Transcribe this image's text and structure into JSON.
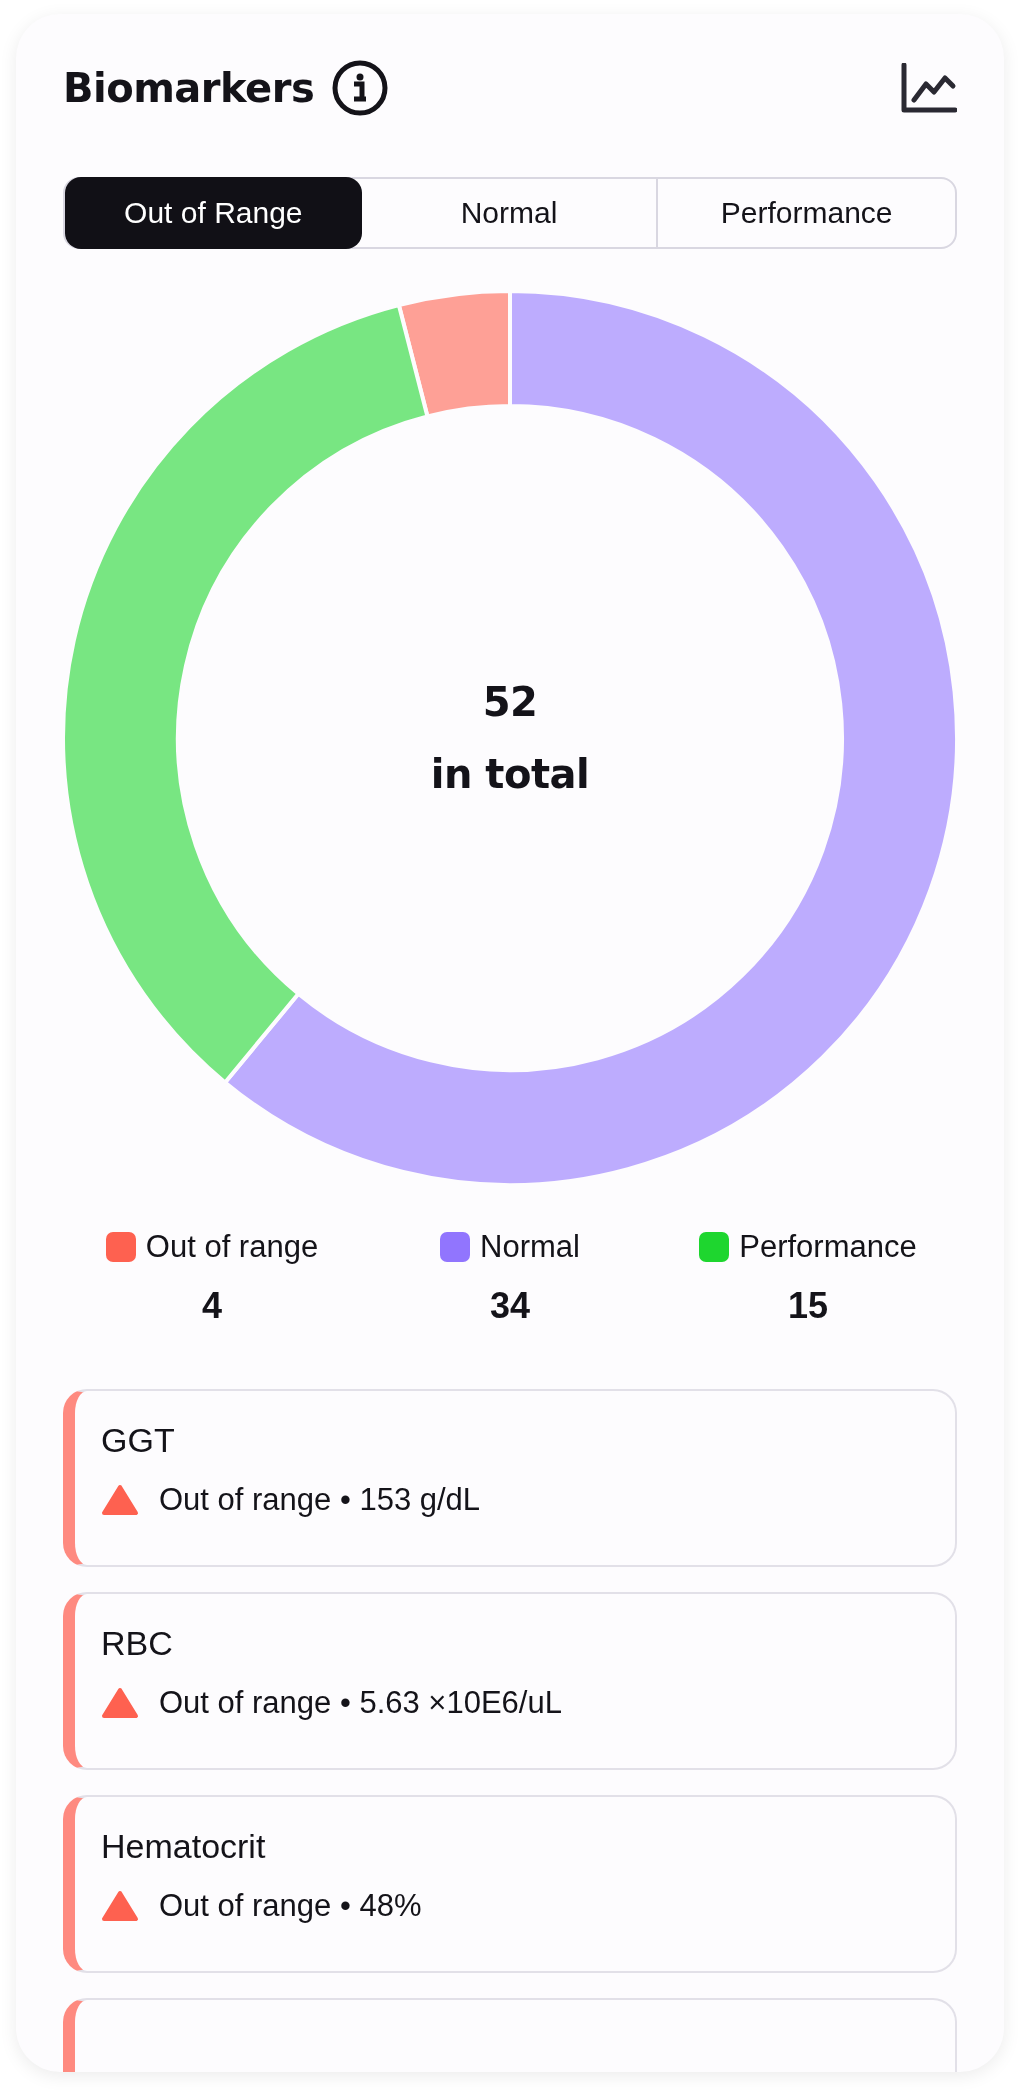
{
  "header": {
    "title": "Biomarkers"
  },
  "tabs": [
    {
      "label": "Out of Range",
      "selected": true
    },
    {
      "label": "Normal",
      "selected": false
    },
    {
      "label": "Performance",
      "selected": false
    }
  ],
  "summary": {
    "total": "52",
    "caption": "in total",
    "chart_data": {
      "type": "donut",
      "categories": [
        "Out of range",
        "Normal",
        "Performance"
      ],
      "series": [
        {
          "values": [
            4,
            61,
            35
          ]
        }
      ]
    }
  },
  "legend": [
    {
      "count": "4",
      "color": "#fe6150"
    },
    {
      "count": "34",
      "color": "#9175fe"
    },
    {
      "count": "15",
      "color": "#1ed62f"
    }
  ],
  "biomarkers": [
    {
      "kind": "full",
      "name": "GGT",
      "status": "Out of range • 153 g/dL"
    },
    {
      "kind": "full",
      "name": "RBC",
      "status": "Out of range • 5.63 ×10E6/uL"
    },
    {
      "kind": "full",
      "name": "Hematocrit",
      "status": "Out of range • 48%"
    },
    {
      "kind": "cut"
    }
  ]
}
